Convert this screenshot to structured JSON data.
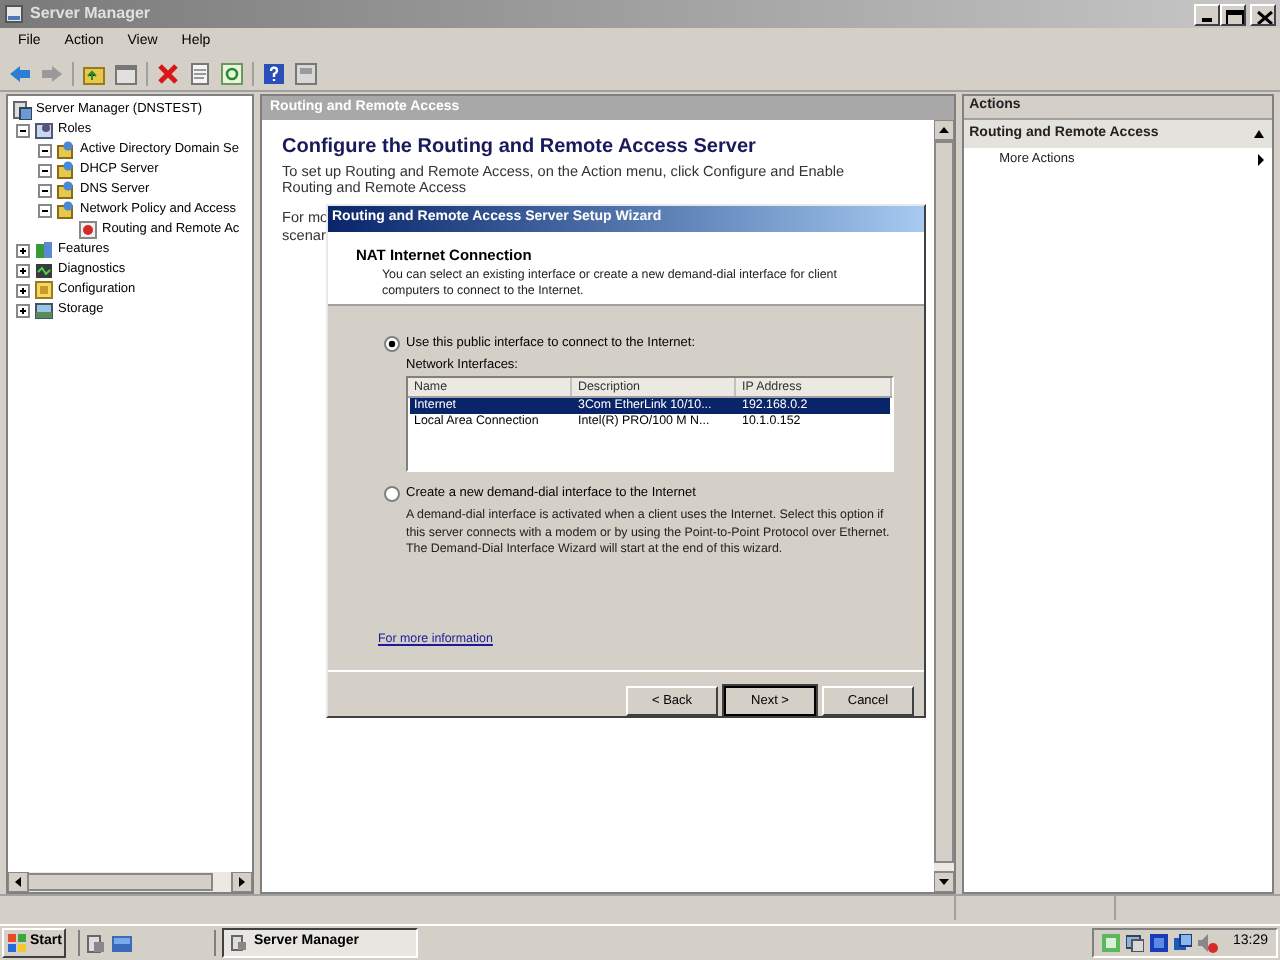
{
  "window": {
    "title": "Server Manager"
  },
  "menu": [
    "File",
    "Action",
    "View",
    "Help"
  ],
  "tree": [
    {
      "label": "Server Manager (DNSTEST)",
      "kind": "server",
      "children": [
        {
          "label": "Roles",
          "kind": "roles",
          "expanded": true,
          "children": [
            {
              "label": "Active Directory Domain Se",
              "kind": "role",
              "expanded": true
            },
            {
              "label": "DHCP Server",
              "kind": "role",
              "expanded": true
            },
            {
              "label": "DNS Server",
              "kind": "role",
              "expanded": true
            },
            {
              "label": "Network Policy and Access",
              "kind": "role",
              "expanded": true,
              "children": [
                {
                  "label": "Routing and Remote Ac",
                  "kind": "routing"
                }
              ]
            }
          ]
        },
        {
          "label": "Features",
          "kind": "features",
          "expanded": false
        },
        {
          "label": "Diagnostics",
          "kind": "diagnostics",
          "expanded": false
        },
        {
          "label": "Configuration",
          "kind": "configuration",
          "expanded": false
        },
        {
          "label": "Storage",
          "kind": "storage",
          "expanded": false
        }
      ]
    }
  ],
  "center": {
    "header": "Routing and Remote Access",
    "heading": "Configure the Routing and Remote Access Server",
    "lines": [
      "To set up Routing and Remote Access, on the Action menu, click Configure and Enable",
      "Routing and Remote Access"
    ],
    "cut_lines": [
      "For mo",
      "scenar"
    ]
  },
  "actions": {
    "header": "Actions",
    "section": "Routing and Remote Access",
    "items": [
      "More Actions"
    ]
  },
  "dialog": {
    "title": "Routing and Remote Access Server Setup Wizard",
    "heading": "NAT Internet Connection",
    "description": "You can select an existing interface or create a new demand-dial interface for client computers to connect to the Internet.",
    "options": [
      {
        "label": "Use this public interface to connect to the Internet:",
        "selected": true
      },
      {
        "label": "Create a new demand-dial interface to the Internet",
        "selected": false,
        "description": "A demand-dial interface is activated when a client uses the Internet. Select this option if this server connects with a modem or by using the Point-to-Point Protocol over Ethernet. The Demand-Dial Interface Wizard will start at the end of this wizard."
      }
    ],
    "list_label": "Network Interfaces:",
    "columns": [
      "Name",
      "Description",
      "IP Address"
    ],
    "rows": [
      {
        "cells": [
          "Internet",
          "3Com EtherLink 10/10...",
          "192.168.0.2"
        ],
        "selected": true
      },
      {
        "cells": [
          "Local Area Connection",
          "Intel(R) PRO/100 M N...",
          "10.1.0.152"
        ],
        "selected": false
      }
    ],
    "link": "For more information",
    "buttons": [
      {
        "label": "< Back",
        "default": false
      },
      {
        "label": "Next >",
        "default": true
      },
      {
        "label": "Cancel",
        "default": false
      }
    ]
  },
  "taskbar": {
    "start": "Start",
    "tasks": [
      "Server Manager"
    ],
    "clock": "13:29"
  }
}
